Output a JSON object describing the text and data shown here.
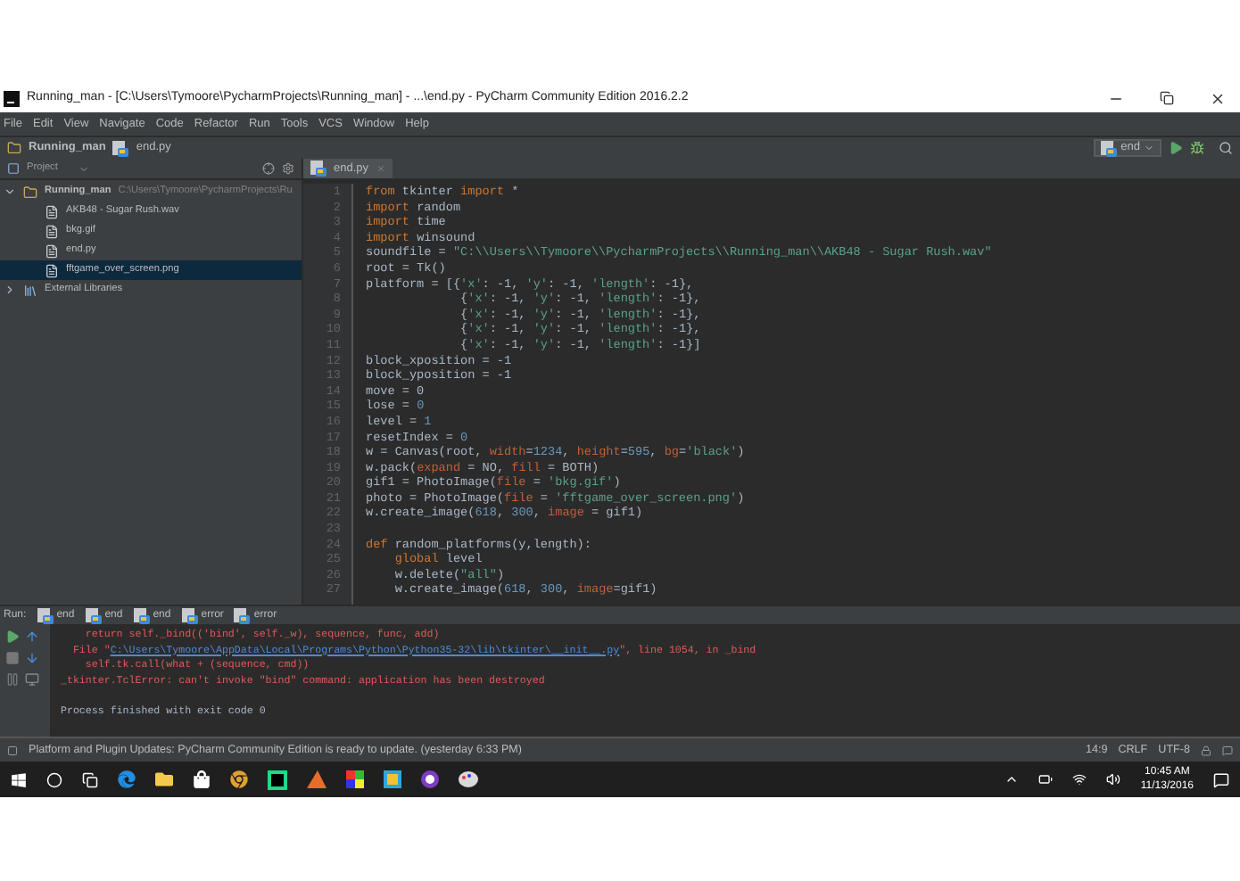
{
  "window": {
    "title": "Running_man - [C:\\Users\\Tymoore\\PycharmProjects\\Running_man] - ...\\end.py - PyCharm Community Edition 2016.2.2"
  },
  "menu": [
    "File",
    "Edit",
    "View",
    "Navigate",
    "Code",
    "Refactor",
    "Run",
    "Tools",
    "VCS",
    "Window",
    "Help"
  ],
  "breadcrumbs": [
    "Running_man",
    "end.py"
  ],
  "run_config": "end",
  "project": {
    "header": "Project",
    "tree": [
      {
        "label": "Running_man",
        "path": "C:\\Users\\Tymoore\\PycharmProjects\\Ru",
        "expanded": true,
        "selected": false,
        "children": [
          {
            "label": "AKB48 - Sugar Rush.wav",
            "selected": false
          },
          {
            "label": "bkg.gif",
            "selected": false
          },
          {
            "label": "end.py",
            "selected": false
          },
          {
            "label": "fftgame_over_screen.png",
            "selected": true
          }
        ]
      },
      {
        "label": "External Libraries",
        "expanded": false,
        "selected": false
      }
    ]
  },
  "editor": {
    "tab": "end.py",
    "lines": [
      {
        "number": "1",
        "tokens": [
          {
            "kind": "keyword",
            "text": "from"
          },
          {
            "kind": "plain",
            "text": " tkinter "
          },
          {
            "kind": "keyword",
            "text": "import"
          },
          {
            "kind": "plain",
            "text": " *"
          }
        ]
      },
      {
        "number": "2",
        "tokens": [
          {
            "kind": "keyword",
            "text": "import"
          },
          {
            "kind": "plain",
            "text": " random"
          }
        ]
      },
      {
        "number": "3",
        "tokens": [
          {
            "kind": "keyword",
            "text": "import"
          },
          {
            "kind": "plain",
            "text": " time"
          }
        ]
      },
      {
        "number": "4",
        "tokens": [
          {
            "kind": "keyword",
            "text": "import"
          },
          {
            "kind": "plain",
            "text": " winsound"
          }
        ]
      },
      {
        "number": "5",
        "tokens": [
          {
            "kind": "plain",
            "text": "soundfile = "
          },
          {
            "kind": "string",
            "text": "\"C:\\\\Users\\\\Tymoore\\\\PycharmProjects\\\\Running_man\\\\AKB48 - Sugar Rush.wav\""
          }
        ]
      },
      {
        "number": "6",
        "tokens": [
          {
            "kind": "plain",
            "text": "root = Tk()"
          }
        ]
      },
      {
        "number": "7",
        "tokens": [
          {
            "kind": "plain",
            "text": "platform = [{"
          },
          {
            "kind": "string",
            "text": "'x'"
          },
          {
            "kind": "plain",
            "text": ": -1, "
          },
          {
            "kind": "string",
            "text": "'y'"
          },
          {
            "kind": "plain",
            "text": ": -1, "
          },
          {
            "kind": "string",
            "text": "'length'"
          },
          {
            "kind": "plain",
            "text": ": -1},"
          }
        ]
      },
      {
        "number": "8",
        "tokens": [
          {
            "kind": "plain",
            "text": "             {"
          },
          {
            "kind": "string",
            "text": "'x'"
          },
          {
            "kind": "plain",
            "text": ": -1, "
          },
          {
            "kind": "string",
            "text": "'y'"
          },
          {
            "kind": "plain",
            "text": ": -1, "
          },
          {
            "kind": "string",
            "text": "'length'"
          },
          {
            "kind": "plain",
            "text": ": -1},"
          }
        ]
      },
      {
        "number": "9",
        "tokens": [
          {
            "kind": "plain",
            "text": "             {"
          },
          {
            "kind": "string",
            "text": "'x'"
          },
          {
            "kind": "plain",
            "text": ": -1, "
          },
          {
            "kind": "string",
            "text": "'y'"
          },
          {
            "kind": "plain",
            "text": ": -1, "
          },
          {
            "kind": "string",
            "text": "'length'"
          },
          {
            "kind": "plain",
            "text": ": -1},"
          }
        ]
      },
      {
        "number": "10",
        "tokens": [
          {
            "kind": "plain",
            "text": "             {"
          },
          {
            "kind": "string",
            "text": "'x'"
          },
          {
            "kind": "plain",
            "text": ": -1, "
          },
          {
            "kind": "string",
            "text": "'y'"
          },
          {
            "kind": "plain",
            "text": ": -1, "
          },
          {
            "kind": "string",
            "text": "'length'"
          },
          {
            "kind": "plain",
            "text": ": -1},"
          }
        ]
      },
      {
        "number": "11",
        "tokens": [
          {
            "kind": "plain",
            "text": "             {"
          },
          {
            "kind": "string",
            "text": "'x'"
          },
          {
            "kind": "plain",
            "text": ": -1, "
          },
          {
            "kind": "string",
            "text": "'y'"
          },
          {
            "kind": "plain",
            "text": ": -1, "
          },
          {
            "kind": "string",
            "text": "'length'"
          },
          {
            "kind": "plain",
            "text": ": -1}]"
          }
        ]
      },
      {
        "number": "12",
        "tokens": [
          {
            "kind": "plain",
            "text": "block_xposition = -1"
          }
        ]
      },
      {
        "number": "13",
        "tokens": [
          {
            "kind": "plain",
            "text": "block_yposition = -1"
          }
        ]
      },
      {
        "number": "14",
        "tokens": [
          {
            "kind": "plain",
            "text": "move = 0"
          }
        ]
      },
      {
        "number": "15",
        "tokens": [
          {
            "kind": "plain",
            "text": "lose = "
          },
          {
            "kind": "number",
            "text": "0"
          }
        ]
      },
      {
        "number": "16",
        "tokens": [
          {
            "kind": "plain",
            "text": "level = "
          },
          {
            "kind": "number",
            "text": "1"
          }
        ]
      },
      {
        "number": "17",
        "tokens": [
          {
            "kind": "plain",
            "text": "resetIndex = "
          },
          {
            "kind": "number",
            "text": "0"
          }
        ]
      },
      {
        "number": "18",
        "tokens": [
          {
            "kind": "plain",
            "text": "w = Canvas(root, "
          },
          {
            "kind": "param",
            "text": "width"
          },
          {
            "kind": "plain",
            "text": "="
          },
          {
            "kind": "number",
            "text": "1234"
          },
          {
            "kind": "plain",
            "text": ", "
          },
          {
            "kind": "param",
            "text": "height"
          },
          {
            "kind": "plain",
            "text": "="
          },
          {
            "kind": "number",
            "text": "595"
          },
          {
            "kind": "plain",
            "text": ", "
          },
          {
            "kind": "param",
            "text": "bg"
          },
          {
            "kind": "plain",
            "text": "="
          },
          {
            "kind": "string",
            "text": "'black'"
          },
          {
            "kind": "plain",
            "text": ")"
          }
        ]
      },
      {
        "number": "19",
        "tokens": [
          {
            "kind": "plain",
            "text": "w.pack("
          },
          {
            "kind": "param",
            "text": "expand"
          },
          {
            "kind": "plain",
            "text": " = NO, "
          },
          {
            "kind": "param",
            "text": "fill"
          },
          {
            "kind": "plain",
            "text": " = BOTH)"
          }
        ]
      },
      {
        "number": "20",
        "tokens": [
          {
            "kind": "plain",
            "text": "gif1 = PhotoImage("
          },
          {
            "kind": "param",
            "text": "file"
          },
          {
            "kind": "plain",
            "text": " = "
          },
          {
            "kind": "string",
            "text": "'bkg.gif'"
          },
          {
            "kind": "plain",
            "text": ")"
          }
        ]
      },
      {
        "number": "21",
        "tokens": [
          {
            "kind": "plain",
            "text": "photo = PhotoImage("
          },
          {
            "kind": "param",
            "text": "file"
          },
          {
            "kind": "plain",
            "text": " = "
          },
          {
            "kind": "string",
            "text": "'fftgame_over_screen.png'"
          },
          {
            "kind": "plain",
            "text": ")"
          }
        ]
      },
      {
        "number": "22",
        "tokens": [
          {
            "kind": "plain",
            "text": "w.create_image("
          },
          {
            "kind": "number",
            "text": "618"
          },
          {
            "kind": "plain",
            "text": ", "
          },
          {
            "kind": "number",
            "text": "300"
          },
          {
            "kind": "plain",
            "text": ", "
          },
          {
            "kind": "param",
            "text": "image"
          },
          {
            "kind": "plain",
            "text": " = gif1)"
          }
        ]
      },
      {
        "number": "23"
      },
      {
        "number": "24",
        "tokens": [
          {
            "kind": "keyword",
            "text": "def"
          },
          {
            "kind": "plain",
            "text": " random_platforms(y,length):"
          }
        ]
      },
      {
        "number": "25",
        "tokens": [
          {
            "kind": "keyword",
            "text": "    global"
          },
          {
            "kind": "plain",
            "text": " level"
          }
        ]
      },
      {
        "number": "26",
        "tokens": [
          {
            "kind": "plain",
            "text": "    w.delete("
          },
          {
            "kind": "string",
            "text": "\"all\""
          },
          {
            "kind": "plain",
            "text": ")"
          }
        ]
      },
      {
        "number": "27",
        "tokens": [
          {
            "kind": "plain",
            "text": "    w.create_image("
          },
          {
            "kind": "number",
            "text": "618"
          },
          {
            "kind": "plain",
            "text": ", "
          },
          {
            "kind": "number",
            "text": "300"
          },
          {
            "kind": "plain",
            "text": ", "
          },
          {
            "kind": "param",
            "text": "image"
          },
          {
            "kind": "plain",
            "text": "=gif1)"
          }
        ]
      }
    ]
  },
  "run": {
    "label": "Run:",
    "tabs": [
      "end",
      "end",
      "end",
      "error",
      "error"
    ],
    "output": [
      {
        "tokens": [
          {
            "kind": "error",
            "text": "    return self._bind(('bind', self._w), sequence, func, add)"
          }
        ]
      },
      {
        "tokens": [
          {
            "kind": "error",
            "text": "  File \""
          },
          {
            "kind": "link",
            "text": "C:\\Users\\Tymoore\\AppData\\Local\\Programs\\Python\\Python35-32\\lib\\tkinter\\__init__.py"
          },
          {
            "kind": "error",
            "text": "\", line 1054, in _bind"
          }
        ]
      },
      {
        "tokens": [
          {
            "kind": "error",
            "text": "    self.tk.call(what + (sequence, cmd))"
          }
        ]
      },
      {
        "tokens": [
          {
            "kind": "error",
            "text": "_tkinter.TclError: can't invoke \"bind\" command: application has been destroyed"
          }
        ]
      },
      {
        "kind": "exit",
        "tokens": [
          {
            "kind": "plain",
            "text": "Process finished with exit code 0"
          }
        ]
      }
    ]
  },
  "status_bar": {
    "message": "Platform and Plugin Updates: PyCharm Community Edition is ready to update. (yesterday 6:33 PM)",
    "position": "14:9",
    "line_separator": "CRLF",
    "encoding": "UTF-8"
  },
  "taskbar": {
    "time": "10:45 AM",
    "date": "11/13/2016"
  }
}
